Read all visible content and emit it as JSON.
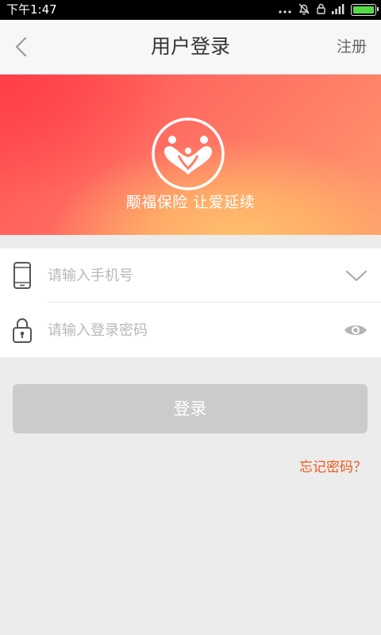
{
  "status_bar": {
    "time": "下午1:47",
    "battery_level": 1.0
  },
  "nav": {
    "back_icon": "chevron-left-icon",
    "title": "用户登录",
    "register_label": "注册"
  },
  "banner": {
    "logo_icon": "heart-family-logo",
    "slogan": "颙福保险 让爱延续"
  },
  "form": {
    "phone": {
      "icon": "phone-icon",
      "placeholder": "请输入手机号",
      "value": "",
      "dropdown_icon": "chevron-down-icon"
    },
    "password": {
      "icon": "lock-icon",
      "placeholder": "请输入登录密码",
      "value": "",
      "toggle_icon": "eye-icon"
    }
  },
  "login_button_label": "登录",
  "forgot_password_label": "忘记密码？",
  "colors": {
    "accent_orange": "#e85a1c",
    "button_disabled": "#cbcbcb",
    "banner_start": "#ff4d52",
    "banner_end": "#ffc16e"
  }
}
